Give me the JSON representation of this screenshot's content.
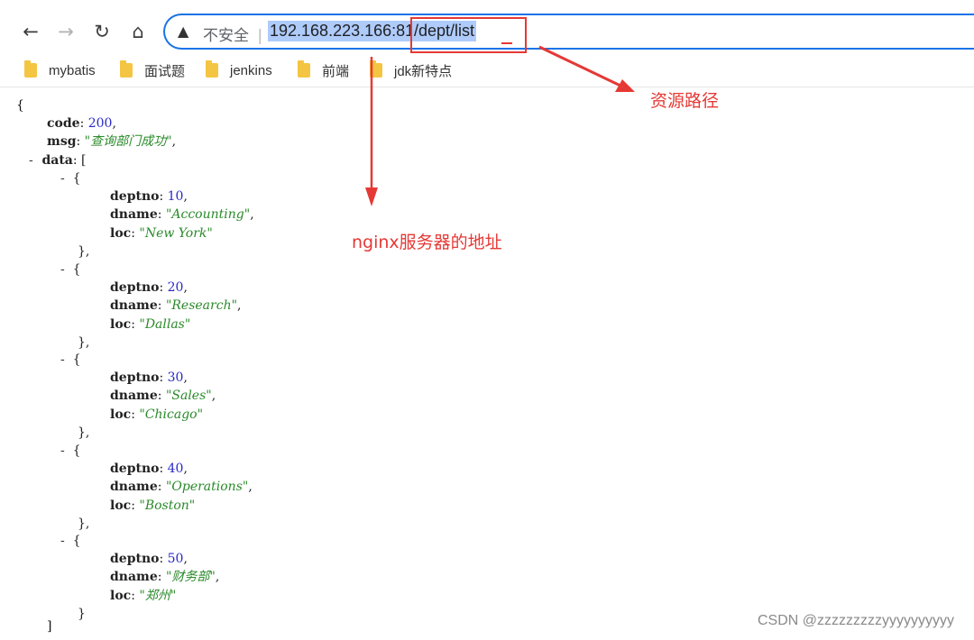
{
  "nav": {
    "back": "←",
    "forward": "→",
    "reload": "↻",
    "home": "⌂"
  },
  "address_bar": {
    "security_label": "不安全",
    "separator": "|",
    "host": "192.168.223.166:81",
    "path": "/dept/list",
    "warning_icon": "warning-triangle-icon"
  },
  "bookmarks": [
    "mybatis",
    "面试题",
    "jenkins",
    "前端",
    "jdk新特点"
  ],
  "json": {
    "code": 200,
    "msg": "查询部门成功",
    "data": [
      {
        "deptno": 10,
        "dname": "Accounting",
        "loc": "New York"
      },
      {
        "deptno": 20,
        "dname": "Research",
        "loc": "Dallas"
      },
      {
        "deptno": 30,
        "dname": "Sales",
        "loc": "Chicago"
      },
      {
        "deptno": 40,
        "dname": "Operations",
        "loc": "Boston"
      },
      {
        "deptno": 50,
        "dname": "财务部",
        "loc": "郑州"
      }
    ]
  },
  "annotations": {
    "resource_path": "资源路径",
    "nginx_address": "nginx服务器的地址",
    "color": "#e53935"
  },
  "watermark": "CSDN @zzzzzzzzzyyyyyyyyyy"
}
